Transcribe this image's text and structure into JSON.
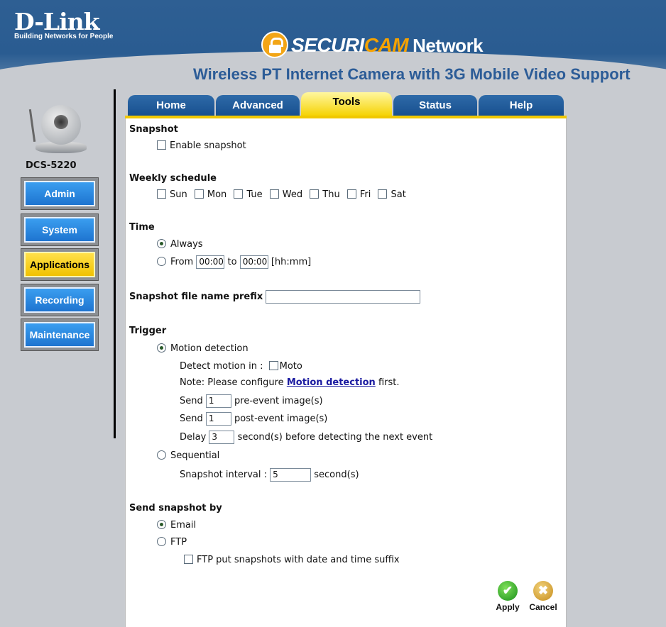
{
  "header": {
    "logo_main": "D-Link",
    "logo_tagline": "Building Networks for People",
    "brand_part1": "SECURI",
    "brand_part2": "CAM",
    "brand_part3": "Network",
    "subtitle": "Wireless PT Internet Camera with 3G Mobile Video Support"
  },
  "sidebar": {
    "model": "DCS-5220",
    "items": [
      {
        "label": "Admin",
        "active": false
      },
      {
        "label": "System",
        "active": false
      },
      {
        "label": "Applications",
        "active": true
      },
      {
        "label": "Recording",
        "active": false
      },
      {
        "label": "Maintenance",
        "active": false
      }
    ]
  },
  "tabs": [
    {
      "label": "Home",
      "active": false
    },
    {
      "label": "Advanced",
      "active": false
    },
    {
      "label": "Tools",
      "active": true
    },
    {
      "label": "Status",
      "active": false
    },
    {
      "label": "Help",
      "active": false
    }
  ],
  "snapshot": {
    "heading": "Snapshot",
    "enable_label": "Enable snapshot",
    "enabled": false
  },
  "schedule": {
    "heading": "Weekly schedule",
    "days": [
      "Sun",
      "Mon",
      "Tue",
      "Wed",
      "Thu",
      "Fri",
      "Sat"
    ]
  },
  "time": {
    "heading": "Time",
    "always_label": "Always",
    "always_selected": true,
    "from_label": "From",
    "from_value": "00:00",
    "to_label": "to",
    "to_value": "00:00",
    "format_hint": "[hh:mm]"
  },
  "prefix": {
    "label": "Snapshot file name prefix",
    "value": ""
  },
  "trigger": {
    "heading": "Trigger",
    "motion_label": "Motion detection",
    "motion_selected": true,
    "detect_in_label": "Detect motion in :",
    "moto_label": "Moto",
    "note_prefix": "Note: Please configure",
    "note_link": "Motion detection",
    "note_suffix": "first.",
    "send_label": "Send",
    "pre_value": "1",
    "pre_label": "pre-event image(s)",
    "post_value": "1",
    "post_label": "post-event image(s)",
    "delay_label": "Delay",
    "delay_value": "3",
    "delay_suffix": "second(s) before detecting the next event",
    "sequential_label": "Sequential",
    "interval_label": "Snapshot interval :",
    "interval_value": "5",
    "interval_suffix": "second(s)"
  },
  "send_by": {
    "heading": "Send snapshot by",
    "email_label": "Email",
    "email_selected": true,
    "ftp_label": "FTP",
    "ftp_suffix_label": "FTP put snapshots with date and time suffix"
  },
  "actions": {
    "apply_label": "Apply",
    "cancel_label": "Cancel"
  }
}
